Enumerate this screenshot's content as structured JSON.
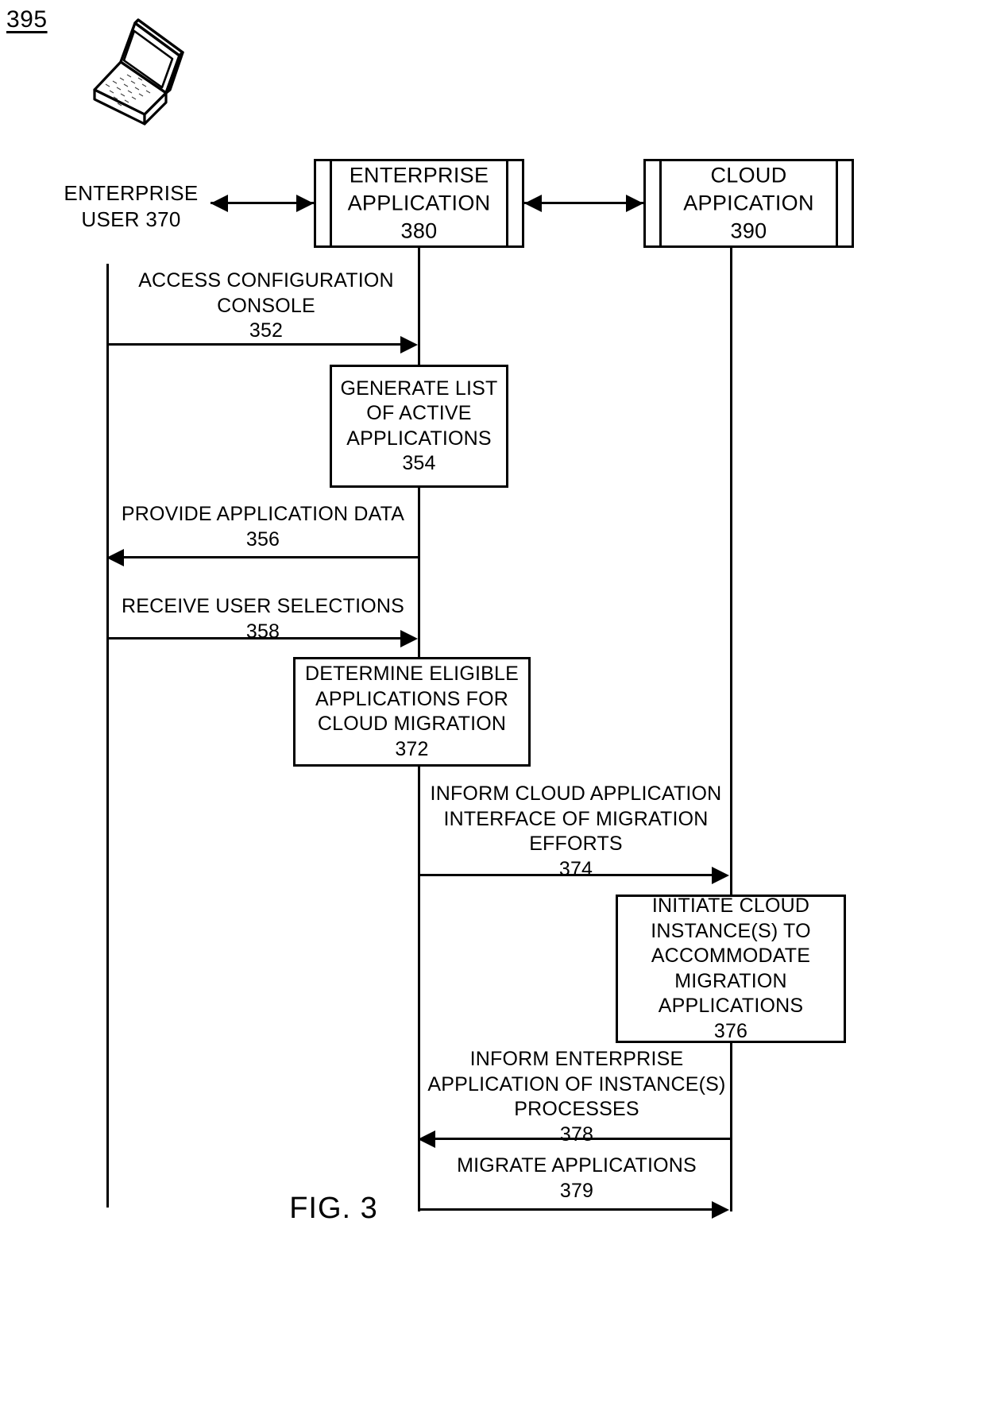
{
  "figure": {
    "reference_numeral": "395",
    "caption": "FIG. 3"
  },
  "actors": [
    {
      "id": "enterprise-user",
      "label": "ENTERPRISE\nUSER 370",
      "numeral": "370",
      "icon": "laptop-icon"
    },
    {
      "id": "enterprise-application",
      "label": "ENTERPRISE\nAPPLICATION\n380",
      "numeral": "380"
    },
    {
      "id": "cloud-application",
      "label": "CLOUD\nAPPICATION\n390",
      "numeral": "390"
    }
  ],
  "top_links": [
    {
      "id": "user-to-enterprise-app",
      "type": "bidirectional"
    },
    {
      "id": "enterprise-app-to-cloud-app",
      "type": "bidirectional"
    }
  ],
  "messages": [
    {
      "id": "352",
      "label": "ACCESS CONFIGURATION\nCONSOLE\n352",
      "from": "enterprise-user",
      "to": "enterprise-application",
      "direction": "right"
    },
    {
      "id": "356",
      "label": "PROVIDE APPLICATION DATA\n356",
      "from": "enterprise-application",
      "to": "enterprise-user",
      "direction": "left"
    },
    {
      "id": "358",
      "label": "RECEIVE USER SELECTIONS\n358",
      "from": "enterprise-user",
      "to": "enterprise-application",
      "direction": "right"
    },
    {
      "id": "374",
      "label": "INFORM CLOUD APPLICATION\nINTERFACE OF MIGRATION\nEFFORTS\n374",
      "from": "enterprise-application",
      "to": "cloud-application",
      "direction": "right"
    },
    {
      "id": "378",
      "label": "INFORM ENTERPRISE\nAPPLICATION OF INSTANCE(S)\nPROCESSES\n378",
      "from": "cloud-application",
      "to": "enterprise-application",
      "direction": "left"
    },
    {
      "id": "379",
      "label": "MIGRATE APPLICATIONS\n379",
      "from": "enterprise-application",
      "to": "cloud-application",
      "direction": "right"
    }
  ],
  "process_boxes": [
    {
      "id": "354",
      "label": "GENERATE LIST\nOF ACTIVE\nAPPLICATIONS\n354",
      "on": "enterprise-application"
    },
    {
      "id": "372",
      "label": "DETERMINE ELIGIBLE\nAPPLICATIONS FOR\nCLOUD MIGRATION\n372",
      "on": "enterprise-application"
    },
    {
      "id": "376",
      "label": "INITIATE CLOUD\nINSTANCE(S) TO\nACCOMMODATE\nMIGRATION\nAPPLICATIONS\n376",
      "on": "cloud-application"
    }
  ],
  "colors": {
    "ink": "#000000",
    "paper": "#ffffff"
  }
}
